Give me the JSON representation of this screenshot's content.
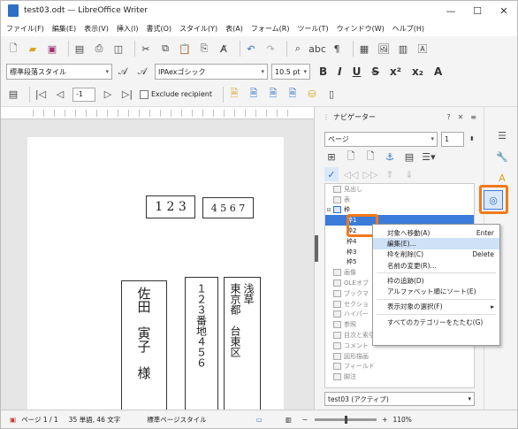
{
  "window": {
    "title": "test03.odt — LibreOffice Writer",
    "min": "—",
    "max": "☐",
    "close": "✕"
  },
  "menu": [
    "ファイル(F)",
    "編集(E)",
    "表示(V)",
    "挿入(I)",
    "書式(O)",
    "スタイル(Y)",
    "表(A)",
    "フォーム(R)",
    "ツール(T)",
    "ウィンドウ(W)",
    "ヘルプ(H)"
  ],
  "toolbar2": {
    "para_style": "標準段落スタイル",
    "font_name": "IPAexゴシック",
    "font_size": "10.5 pt"
  },
  "toolbar3": {
    "record_value": "-1",
    "exclude_label": "Exclude recipient"
  },
  "document": {
    "postal1": "1 2 3",
    "postal2": "4 5 6 7",
    "name": "佐田　寅子　様",
    "address_line2": "１２３番地４５６",
    "address_line1": "東京都　台東区",
    "address_line0": "浅草"
  },
  "navigator": {
    "title": "ナビゲーター",
    "help": "?",
    "close": "✕",
    "menu": "≡",
    "page_select": "ページ",
    "page_number": "1",
    "tree": [
      {
        "label": "見出し",
        "expanded": false,
        "indent": 0,
        "dim": true
      },
      {
        "label": "表",
        "expanded": false,
        "indent": 0,
        "dim": true
      },
      {
        "label": "枠",
        "expanded": true,
        "indent": 0,
        "dim": false
      },
      {
        "label": "枠1",
        "expanded": false,
        "indent": 1,
        "dim": false,
        "selected": true
      },
      {
        "label": "枠2",
        "expanded": false,
        "indent": 1,
        "dim": false
      },
      {
        "label": "枠4",
        "expanded": false,
        "indent": 1,
        "dim": false
      },
      {
        "label": "枠3",
        "expanded": false,
        "indent": 1,
        "dim": false
      },
      {
        "label": "枠5",
        "expanded": false,
        "indent": 1,
        "dim": false
      },
      {
        "label": "画像",
        "expanded": false,
        "indent": 0,
        "dim": true
      },
      {
        "label": "OLEオブ",
        "expanded": false,
        "indent": 0,
        "dim": true
      },
      {
        "label": "ブックマ",
        "expanded": false,
        "indent": 0,
        "dim": true
      },
      {
        "label": "セクショ",
        "expanded": false,
        "indent": 0,
        "dim": true
      },
      {
        "label": "ハイパー",
        "expanded": false,
        "indent": 0,
        "dim": true
      },
      {
        "label": "参照",
        "expanded": false,
        "indent": 0,
        "dim": true
      },
      {
        "label": "目次と索引",
        "expanded": false,
        "indent": 0,
        "dim": true
      },
      {
        "label": "コメント",
        "expanded": false,
        "indent": 0,
        "dim": true
      },
      {
        "label": "図形描画",
        "expanded": false,
        "indent": 0,
        "dim": true
      },
      {
        "label": "フィールド",
        "expanded": false,
        "indent": 0,
        "dim": true
      },
      {
        "label": "脚注",
        "expanded": false,
        "indent": 0,
        "dim": true
      }
    ],
    "document_select": "test03 (アクティブ)"
  },
  "context_menu": [
    {
      "label": "対象へ移動(A)",
      "shortcut": "Enter"
    },
    {
      "label": "編集(E)...",
      "shortcut": "",
      "hover": true
    },
    {
      "label": "枠を削除(C)",
      "shortcut": "Delete"
    },
    {
      "label": "名前の変更(R)...",
      "shortcut": ""
    },
    {
      "sep": true
    },
    {
      "label": "枠の追跡(D)",
      "shortcut": ""
    },
    {
      "label": "アルファベット順にソート(E)",
      "shortcut": ""
    },
    {
      "sep": true
    },
    {
      "label": "表示対象の選択(F)",
      "shortcut": "▸"
    },
    {
      "sep": true
    },
    {
      "label": "すべてのカテゴリーをたたむ(G)",
      "shortcut": ""
    }
  ],
  "status": {
    "page": "ページ 1 / 1",
    "words": "35 単語, 46 文字",
    "page_style": "標準ページスタイル",
    "zoom": "110%"
  },
  "colors": {
    "highlight": "#f07a1b",
    "selection": "#3b7bd9"
  }
}
